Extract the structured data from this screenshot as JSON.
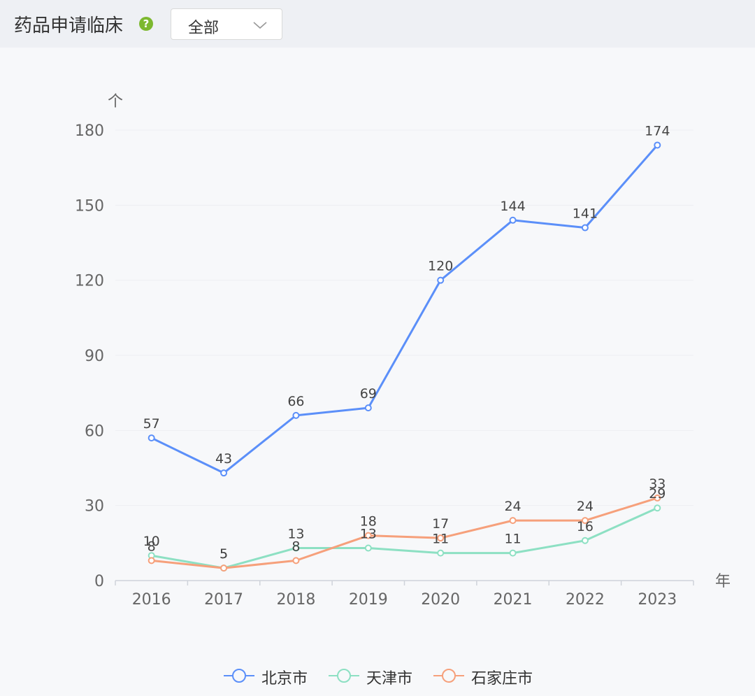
{
  "header": {
    "title": "药品申请临床",
    "help_icon": "question-circle-icon",
    "filter": {
      "selected": "全部",
      "icon": "chevron-down-icon"
    }
  },
  "colors": {
    "header_bg": "#eef0f4",
    "content_bg": "#f7f8fa",
    "help_icon": "#7cb82f",
    "axis": "#666666",
    "grid": "#eceef2"
  },
  "chart_data": {
    "type": "line",
    "x": [
      "2016",
      "2017",
      "2018",
      "2019",
      "2020",
      "2021",
      "2022",
      "2023"
    ],
    "xlabel": "年",
    "ylabel": "个",
    "ylim": [
      0,
      180
    ],
    "yticks": [
      0,
      30,
      60,
      90,
      120,
      150,
      180
    ],
    "grid": true,
    "legend_position": "bottom-center",
    "series": [
      {
        "name": "北京市",
        "color": "#5b8ff9",
        "values": [
          57,
          43,
          66,
          69,
          120,
          144,
          141,
          174
        ]
      },
      {
        "name": "天津市",
        "color": "#8de0c3",
        "values": [
          10,
          5,
          13,
          13,
          11,
          11,
          16,
          29
        ]
      },
      {
        "name": "石家庄市",
        "color": "#f6a07b",
        "values": [
          8,
          5,
          8,
          18,
          17,
          24,
          24,
          33
        ]
      }
    ]
  }
}
